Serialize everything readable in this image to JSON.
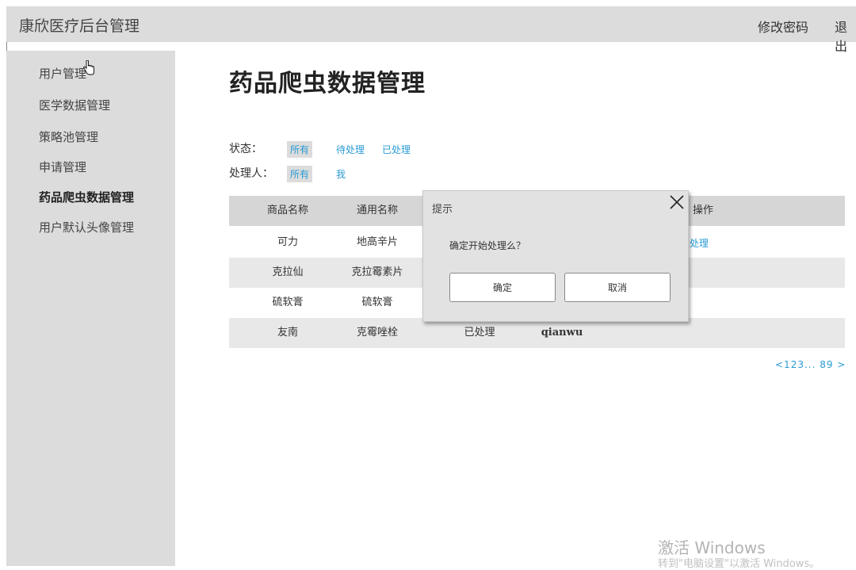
{
  "header": {
    "app_title": "康欣医疗后台管理",
    "change_password": "修改密码",
    "logout": "退出"
  },
  "sidebar": {
    "items": [
      {
        "label": "用户管理"
      },
      {
        "label": "医学数据管理"
      },
      {
        "label": "策略池管理"
      },
      {
        "label": "申请管理"
      },
      {
        "label": "药品爬虫数据管理",
        "active": true
      },
      {
        "label": "用户默认头像管理"
      }
    ]
  },
  "main": {
    "title": "药品爬虫数据管理",
    "filters": {
      "status_label": "状态：",
      "status_options": [
        "所有",
        "待处理",
        "已处理"
      ],
      "status_selected": "所有",
      "handler_label": "处理人：",
      "handler_options": [
        "所有",
        "我"
      ],
      "handler_selected": "所有"
    },
    "table": {
      "headers": [
        "商品名称",
        "通用名称",
        "操作"
      ],
      "rows": [
        {
          "name": "可力",
          "generic": "地高辛片",
          "action": "处理"
        },
        {
          "name": "克拉仙",
          "generic": "克拉霉素片"
        },
        {
          "name": "硫软膏",
          "generic": "硫软膏"
        },
        {
          "name": "友南",
          "generic": "克霉唑栓",
          "status": "已处理",
          "handler": "qianwu"
        }
      ]
    },
    "pagination": "<123... 89 >"
  },
  "dialog": {
    "title": "提示",
    "message": "确定开始处理么？",
    "confirm_label": "确定",
    "cancel_label": "取消"
  },
  "watermark": {
    "line1": "激活 Windows",
    "line2": "转到\"电脑设置\"以激活 Windows。"
  },
  "colors": {
    "link": "#2a9bd5",
    "sidebar_bg": "#dcdcdc",
    "header_bg": "#dcdcdc"
  }
}
